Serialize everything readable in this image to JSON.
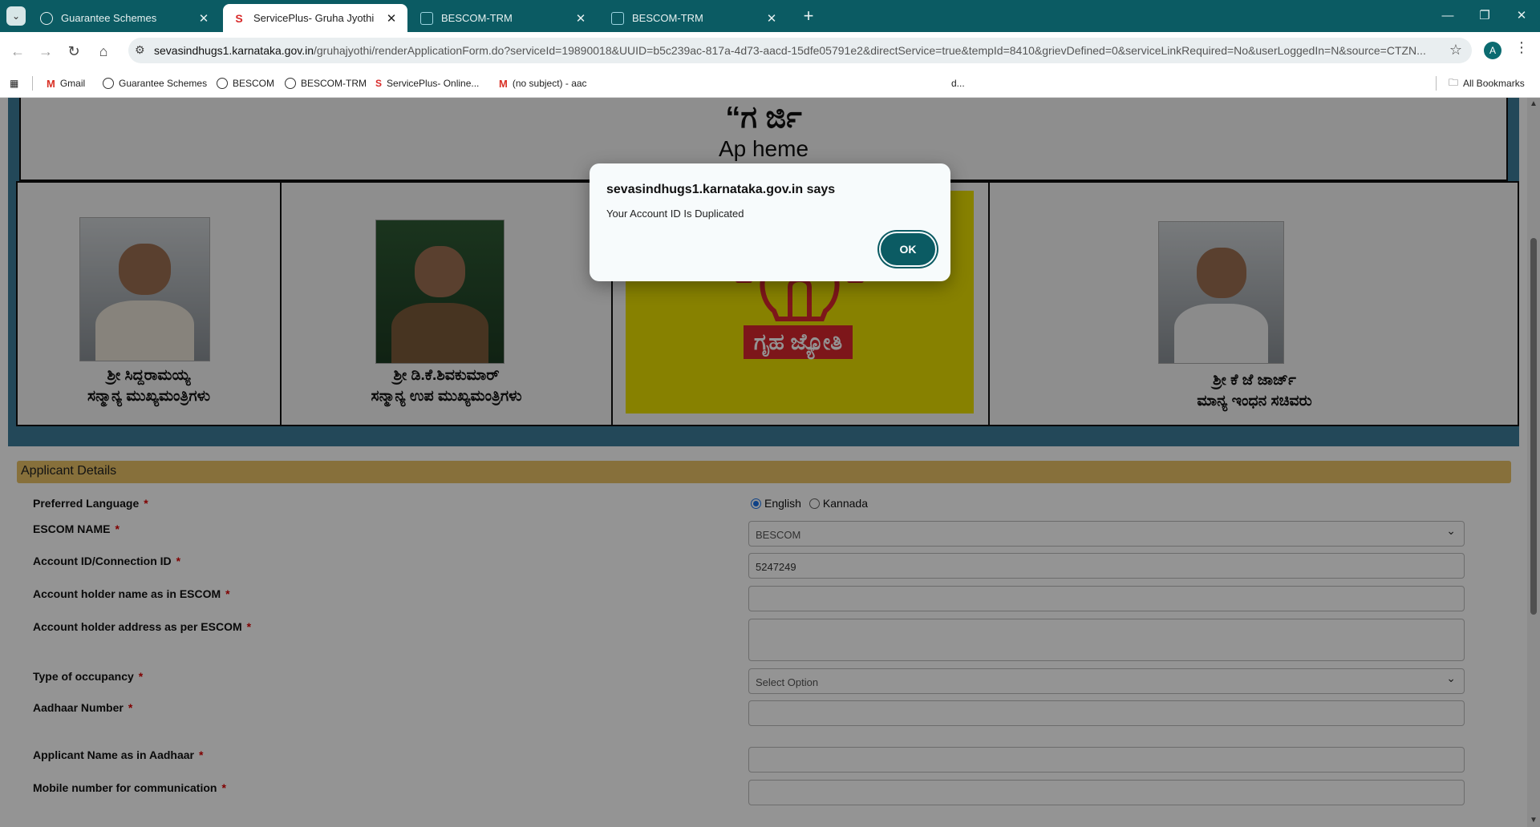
{
  "browser": {
    "tabs": [
      {
        "title": "Guarantee Schemes",
        "active": false
      },
      {
        "title": "ServicePlus- Gruha Jyothi Schem",
        "active": true
      },
      {
        "title": "BESCOM-TRM",
        "active": false
      },
      {
        "title": "BESCOM-TRM",
        "active": false
      }
    ],
    "url_host": "sevasindhugs1.karnataka.gov.in",
    "url_path": "/gruhajyothi/renderApplicationForm.do?serviceId=19890018&UUID=b5c239ac-817a-4d73-aacd-15dfe05791e2&directService=true&tempId=8410&grievDefined=0&serviceLinkRequired=No&userLoggedIn=N&source=CTZN...",
    "profile_initial": "A",
    "bookmarks": [
      "Gmail",
      "Guarantee Schemes",
      "BESCOM",
      "BESCOM-TRM",
      "ServicePlus- Online...",
      "(no subject) - aac",
      "d..."
    ],
    "all_bookmarks": "All Bookmarks"
  },
  "banner": {
    "heading_kn": "“ಗ                                                 ರ್ಜಿ",
    "heading_en": "Ap                                                            heme",
    "people": [
      {
        "name": "ಶ್ರೀ ಸಿದ್ದರಾಮಯ್ಯ",
        "title": "ಸನ್ಮಾನ್ಯ ಮುಖ್ಯಮಂತ್ರಿಗಳು"
      },
      {
        "name": "ಶ್ರೀ ಡಿ.ಕೆ.ಶಿವಕುಮಾರ್",
        "title": "ಸನ್ಮಾನ್ಯ ಉಪ ಮುಖ್ಯಮಂತ್ರಿಗಳು"
      },
      {
        "name": "ಶ್ರೀ ಕೆ ಜೆ ಜಾರ್ಜ್",
        "title": "ಮಾನ್ಯ ಇಂಧನ ಸಚಿವರು"
      }
    ],
    "logo_text": "ಗೃಹ ಜ್ಯೋತಿ"
  },
  "form": {
    "section_title": "Applicant Details",
    "required_mark": "*",
    "language_label": "Preferred Language",
    "language_options": [
      "English",
      "Kannada"
    ],
    "escom_label": "ESCOM NAME",
    "escom_value": "BESCOM",
    "account_label": "Account ID/Connection ID",
    "account_value": "5247249",
    "holder_name_label": "Account holder name as in ESCOM",
    "holder_address_label": "Account holder address as per ESCOM",
    "occupancy_label": "Type of occupancy",
    "occupancy_value": "Select Option",
    "aadhaar_label": "Aadhaar Number",
    "applicant_name_label": "Applicant Name as in Aadhaar",
    "mobile_label": "Mobile number for communication"
  },
  "dialog": {
    "title": "sevasindhugs1.karnataka.gov.in says",
    "message": "Your Account ID Is Duplicated",
    "ok_label": "OK"
  },
  "colors": {
    "tabbar": "#0b5b63",
    "section_bar": "#e8c266",
    "banner_bg": "#3d7c9a",
    "logo_bg": "#e8df00"
  }
}
